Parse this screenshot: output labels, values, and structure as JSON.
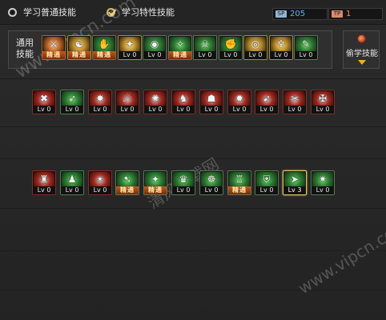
{
  "tabs": {
    "normal_label": "学习普通技能",
    "special_label": "学习特性技能",
    "selected": "special"
  },
  "points": {
    "sp_label": "SP",
    "sp_value": "205",
    "tp_label": "TP",
    "tp_value": "1"
  },
  "general": {
    "label": "通用\n技能",
    "skills": [
      {
        "lv": "精通",
        "color": "orange",
        "glyph": "⚔",
        "icon": "weapon-mastery-icon"
      },
      {
        "lv": "精通",
        "color": "gold",
        "glyph": "☯",
        "icon": "leap-icon"
      },
      {
        "lv": "精通",
        "color": "green",
        "glyph": "✋",
        "icon": "grab-icon"
      },
      {
        "lv": "Lv 0",
        "color": "gold",
        "glyph": "✦",
        "icon": "wings-icon"
      },
      {
        "lv": "Lv 0",
        "color": "green",
        "glyph": "◉",
        "icon": "orb-icon"
      },
      {
        "lv": "精通",
        "color": "green",
        "glyph": "✧",
        "icon": "crosshair-icon"
      },
      {
        "lv": "Lv 0",
        "color": "green",
        "glyph": "☠",
        "icon": "warrior-icon"
      },
      {
        "lv": "Lv 0",
        "color": "green",
        "glyph": "✊",
        "icon": "fist-icon"
      },
      {
        "lv": "Lv 0",
        "color": "gold",
        "glyph": "◎",
        "icon": "target-icon"
      },
      {
        "lv": "Lv 0",
        "color": "gold",
        "glyph": "♆",
        "icon": "golden-figure-icon"
      },
      {
        "lv": "Lv 0",
        "color": "green",
        "glyph": "✎",
        "icon": "scroll-icon"
      }
    ]
  },
  "steal": {
    "label": "偷学技能"
  },
  "row1": [
    {
      "lv": "Lv 0",
      "color": "red",
      "glyph": "✖"
    },
    {
      "lv": "Lv 0",
      "color": "green",
      "glyph": "➶"
    },
    {
      "lv": "Lv 0",
      "color": "red",
      "glyph": "✸"
    },
    {
      "lv": "Lv 0",
      "color": "red",
      "glyph": "☄"
    },
    {
      "lv": "Lv 0",
      "color": "red",
      "glyph": "✺"
    },
    {
      "lv": "Lv 0",
      "color": "red",
      "glyph": "♞"
    },
    {
      "lv": "Lv 0",
      "color": "red",
      "glyph": "☗"
    },
    {
      "lv": "Lv 0",
      "color": "red",
      "glyph": "✹"
    },
    {
      "lv": "Lv 0",
      "color": "red",
      "glyph": "➹"
    },
    {
      "lv": "Lv 0",
      "color": "red",
      "glyph": "✂"
    },
    {
      "lv": "Lv 0",
      "color": "red",
      "glyph": "✠"
    }
  ],
  "row2": [
    {
      "lv": "Lv 0",
      "color": "red",
      "glyph": "♜"
    },
    {
      "lv": "Lv 0",
      "color": "green",
      "glyph": "♟"
    },
    {
      "lv": "Lv 0",
      "color": "red",
      "glyph": "✴"
    },
    {
      "lv": "精通",
      "color": "green",
      "glyph": "➷"
    },
    {
      "lv": "精通",
      "color": "green",
      "glyph": "✦"
    },
    {
      "lv": "Lv 0",
      "color": "green",
      "glyph": "♛"
    },
    {
      "lv": "Lv 0",
      "color": "green",
      "glyph": "☸"
    },
    {
      "lv": "精通",
      "color": "green",
      "glyph": "♖"
    },
    {
      "lv": "Lv 0",
      "color": "green",
      "glyph": "⛨"
    },
    {
      "lv": "Lv 3",
      "color": "green",
      "glyph": "➤",
      "selected": true
    },
    {
      "lv": "Lv 0",
      "color": "green",
      "glyph": "✷"
    }
  ],
  "watermark": {
    "line1": "www.vipcn.com",
    "line2": "清风下载网",
    "line3": "www.vipcn.com"
  }
}
